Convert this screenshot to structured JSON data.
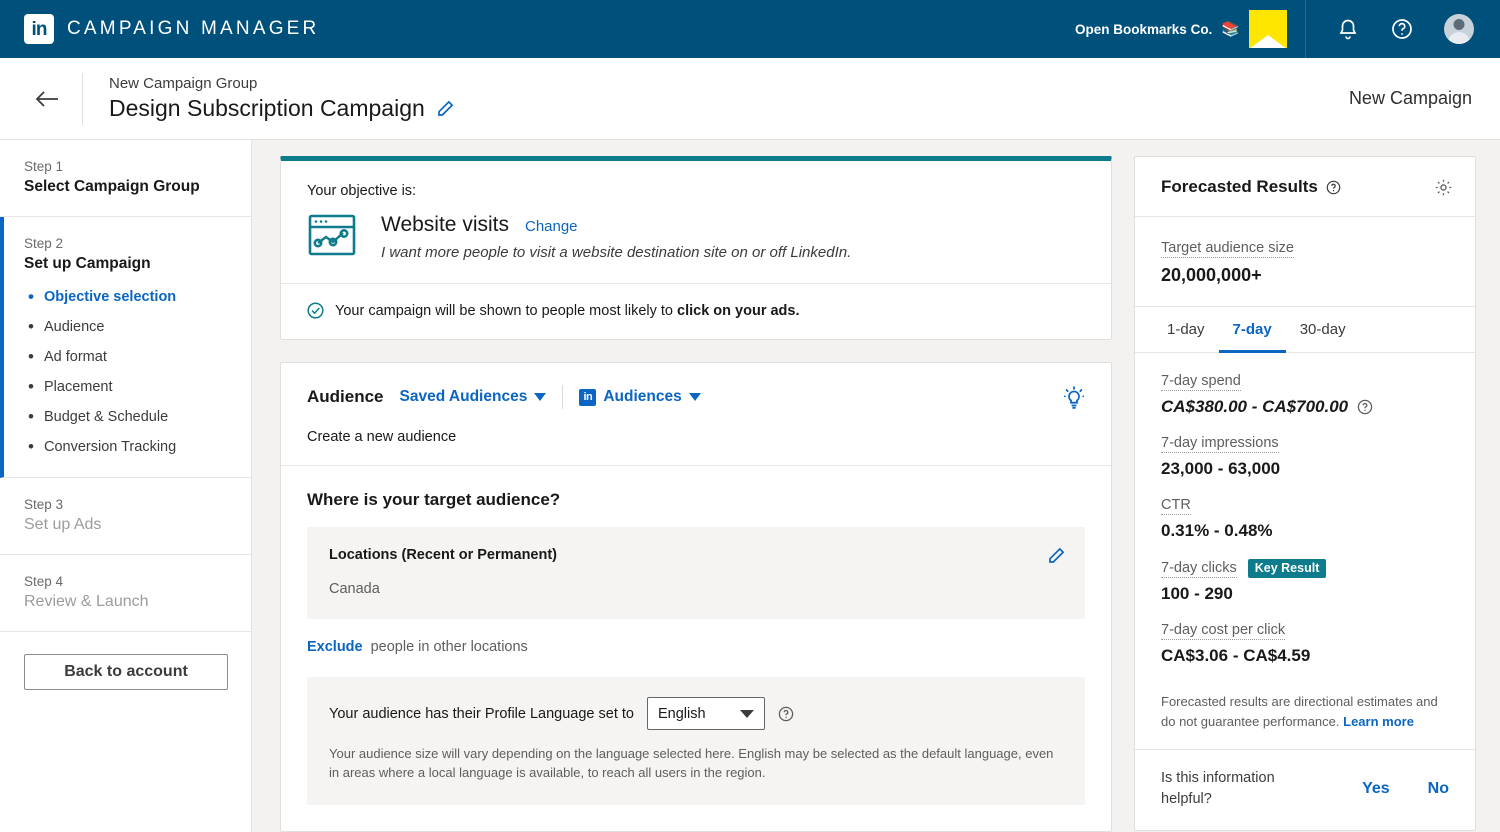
{
  "topnav": {
    "brand": "CAMPAIGN MANAGER",
    "logo_icon": "linkedin-icon",
    "account_name": "Open Bookmarks Co.",
    "account_emoji": "📚",
    "account_logo_icon": "bookmark-logo-icon",
    "bell_icon": "notifications-bell-icon",
    "help_icon": "help-circle-icon",
    "avatar_icon": "user-avatar",
    "bg_color": "#00507c",
    "logo_bg_color": "#ffe600"
  },
  "subheader": {
    "back_icon": "back-arrow-icon",
    "group_label": "New Campaign Group",
    "campaign_title": "Design Subscription Campaign",
    "edit_icon": "pencil-icon",
    "right_label": "New Campaign"
  },
  "sidebar": {
    "steps": [
      {
        "label": "Step 1",
        "name": "Select Campaign Group",
        "state": "done"
      },
      {
        "label": "Step 2",
        "name": "Set up Campaign",
        "state": "active"
      },
      {
        "label": "Step 3",
        "name": "Set up Ads",
        "state": "future"
      },
      {
        "label": "Step 4",
        "name": "Review & Launch",
        "state": "future"
      }
    ],
    "substeps": [
      "Objective selection",
      "Audience",
      "Ad format",
      "Placement",
      "Budget & Schedule",
      "Conversion Tracking"
    ],
    "selected_substep": "Objective selection",
    "back_button": "Back to account"
  },
  "objective": {
    "accent_color": "#0e7c8c",
    "lead": "Your objective is:",
    "icon": "website-visits-icon",
    "name": "Website visits",
    "change_label": "Change",
    "description": "I want more people to visit a website destination site on or off LinkedIn.",
    "note_icon": "check-circle-icon",
    "note_prefix": "Your campaign will be shown to people most likely to ",
    "note_bold": "click on your ads."
  },
  "audience": {
    "title": "Audience",
    "saved_audiences": "Saved Audiences",
    "audiences": "Audiences",
    "audiences_badge_icon": "linkedin-badge-icon",
    "tips_icon": "lightbulb-icon",
    "subtitle": "Create a new audience",
    "question": "Where is your target audience?",
    "location": {
      "title": "Locations (Recent or Permanent)",
      "value": "Canada",
      "edit_icon": "pencil-icon"
    },
    "exclude_link": "Exclude",
    "exclude_text": "people in other locations",
    "language": {
      "prefix": "Your audience has their Profile Language set to",
      "selected": "English",
      "caret_icon": "chevron-down-icon",
      "help_icon": "help-circle-icon",
      "note": "Your audience size will vary depending on the language selected here. English may be selected as the default language, even in areas where a local language is available, to reach all users in the region."
    }
  },
  "forecast": {
    "title": "Forecasted Results",
    "title_help_icon": "help-circle-icon",
    "settings_icon": "gear-icon",
    "audience_size_label": "Target audience size",
    "audience_size_value": "20,000,000+",
    "tabs": [
      {
        "label": "1-day",
        "active": false
      },
      {
        "label": "7-day",
        "active": true
      },
      {
        "label": "30-day",
        "active": false
      }
    ],
    "metrics": [
      {
        "label": "7-day spend",
        "value": "CA$380.00 - CA$700.00",
        "italic": true,
        "help_icon": "help-circle-icon",
        "badge": ""
      },
      {
        "label": "7-day impressions",
        "value": "23,000 - 63,000",
        "italic": false,
        "help_icon": "",
        "badge": ""
      },
      {
        "label": "CTR",
        "value": "0.31% - 0.48%",
        "italic": false,
        "help_icon": "",
        "badge": ""
      },
      {
        "label": "7-day clicks",
        "value": "100 - 290",
        "italic": false,
        "help_icon": "",
        "badge": "Key Result"
      },
      {
        "label": "7-day cost per click",
        "value": "CA$3.06 - CA$4.59",
        "italic": false,
        "help_icon": "",
        "badge": ""
      }
    ],
    "badge_color": "#0e7c8c",
    "disclaimer": "Forecasted results are directional estimates and do not guarantee performance.",
    "learn_more": "Learn more",
    "helpful_question": "Is this information helpful?",
    "yes_label": "Yes",
    "no_label": "No"
  }
}
